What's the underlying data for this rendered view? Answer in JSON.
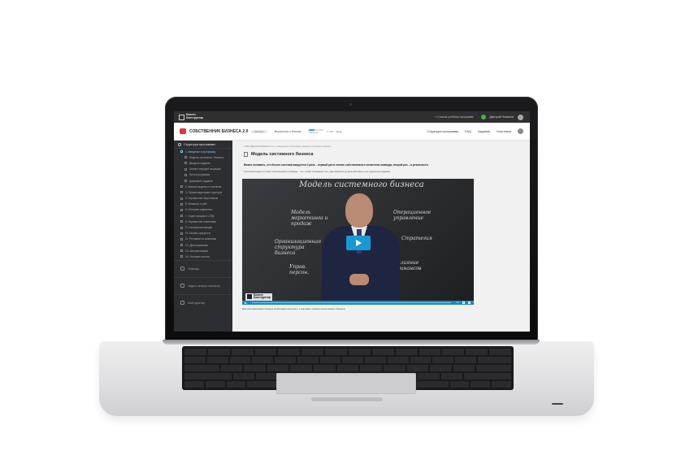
{
  "topbar": {
    "logo_text_1": "Бизнес",
    "logo_text_2": "Конструктор",
    "back_link": "« Список учебных программ",
    "user_name": "Дмитрий Ковалев"
  },
  "header": {
    "brand": "СОБСТВЕННИК БИЗНЕСА 2.0",
    "tag": "Эксперт",
    "nav_link": "Вернуться к блогам",
    "progress_label": "Прогресс",
    "progress_fraction": 0.35,
    "stat_1": "9 / 38",
    "stat_2": "Эфир",
    "menu": [
      "Структура программы",
      "FAQ",
      "Задания",
      "Участники"
    ]
  },
  "sidebar": {
    "section_title": "Структура программы",
    "items": [
      {
        "label": "1. Введение в программу",
        "active": true,
        "sub": false
      },
      {
        "label": "Модель системного бизнеса",
        "active": false,
        "sub": true
      },
      {
        "label": "Вводное задание",
        "active": false,
        "sub": true
      },
      {
        "label": "Анализ текущей ситуации",
        "active": false,
        "sub": true
      },
      {
        "label": "Цели программы",
        "active": false,
        "sub": true
      },
      {
        "label": "Домашнее задание",
        "active": false,
        "sub": true
      },
      {
        "label": "2. Анализ модели и стратегии",
        "active": false,
        "sub": false
      },
      {
        "label": "3. Организационная структура",
        "active": false,
        "sub": false
      },
      {
        "label": "4. Управление персоналом",
        "active": false,
        "sub": false
      },
      {
        "label": "5. Финансы и учёт",
        "active": false,
        "sub": false
      },
      {
        "label": "6. Интернет-маркетинг",
        "active": false,
        "sub": false
      },
      {
        "label": "7. Отдел продаж и CRM",
        "active": false,
        "sub": false
      },
      {
        "label": "8. Управление клиентами",
        "active": false,
        "sub": false
      },
      {
        "label": "9. Система мотивации",
        "active": false,
        "sub": false
      },
      {
        "label": "10. Бизнес-процессы",
        "active": false,
        "sub": false
      },
      {
        "label": "11. Регламенты компании",
        "active": false,
        "sub": false
      },
      {
        "label": "12. Делегирование",
        "active": false,
        "sub": false
      },
      {
        "label": "13. Автоматизация",
        "active": false,
        "sub": false
      },
      {
        "label": "14. Итоговая сессия",
        "active": false,
        "sub": false
      }
    ],
    "footer": [
      "Помощь",
      "Задать вопрос эксперту",
      "Мой куратор"
    ]
  },
  "content": {
    "breadcrumb": "СОБСТВЕННИК БИЗНЕСА 2.0  »  1. Введение в программу  »  Модель системного бизнеса",
    "title": "Модель системного бизнеса",
    "lead": "Важно понимать, что бизнес систематизируется 2 раза – первый раз в голове собственника и элементов команды, второй раз – в реальности.",
    "note": "Систематизация в голове собственника и команды – это «точки понимания того, как компания должна работать» и ее идеальное видение.",
    "video": {
      "board_title": "Модель системного бизнеса",
      "board_1": "Модель маркетинга и продаж",
      "board_2": "Операционное управление",
      "board_3": "Организационная структура бизнеса",
      "board_4": "Стратегия",
      "board_5": "Управ. персон.",
      "board_6": "Влияние финансов",
      "logo_1": "Бизнес",
      "logo_2": "Конструктор",
      "time": "4:1"
    },
    "caption": "Для систематизации бизнеса необходимо выстроить 7 ключевых элементов системного бизнеса."
  }
}
